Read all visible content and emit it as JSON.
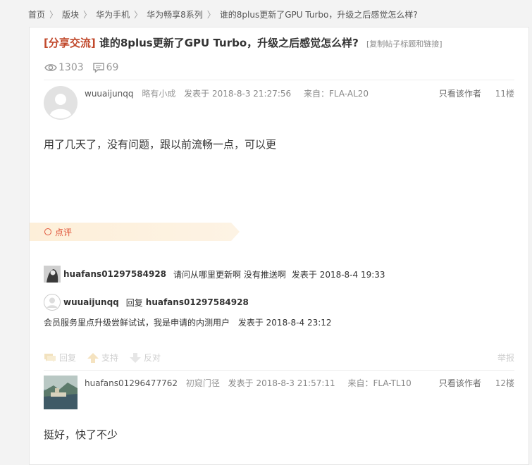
{
  "breadcrumb": [
    "首页",
    "版块",
    "华为手机",
    "华为畅享8系列",
    "谁的8plus更新了GPU Turbo，升级之后感觉怎么样?"
  ],
  "thread": {
    "tag": "[分享交流]",
    "title": "谁的8plus更新了GPU Turbo，升级之后感觉怎么样?",
    "copy_link": "[复制帖子标题和链接]",
    "views": "1303",
    "replies": "69"
  },
  "posts": [
    {
      "user": "wuuaijunqq",
      "rank": "略有小成",
      "posted": "发表于 2018-8-3 21:27:56",
      "from": "来自：FLA-AL20",
      "only_author": "只看该作者",
      "floor": "11楼",
      "content": "用了几天了，没有问题，跟以前流畅一点，可以更"
    },
    {
      "user": "huafans01296477762",
      "rank": "初窥门径",
      "posted": "发表于 2018-8-3 21:57:11",
      "from": "来自：FLA-TL10",
      "only_author": "只看该作者",
      "floor": "12楼",
      "content": "挺好，快了不少"
    }
  ],
  "comments_label": "点评",
  "comments": [
    {
      "user": "huafans01297584928",
      "text": "请问从哪里更新啊 没有推送啊",
      "time": "发表于 2018-8-4 19:33"
    },
    {
      "user": "wuuaijunqq",
      "reply_word": "回复",
      "reply_to": "huafans01297584928",
      "text": "会员服务里点升级尝鲜试试，我是申请的内测用户",
      "time": "发表于 2018-8-4 23:12"
    }
  ],
  "actions": {
    "reply": "回复",
    "support": "支持",
    "oppose": "反对",
    "report": "举报"
  },
  "colors": {
    "tag": "#c1492c",
    "accent": "#e0553a",
    "banner": "#fdefd9"
  }
}
